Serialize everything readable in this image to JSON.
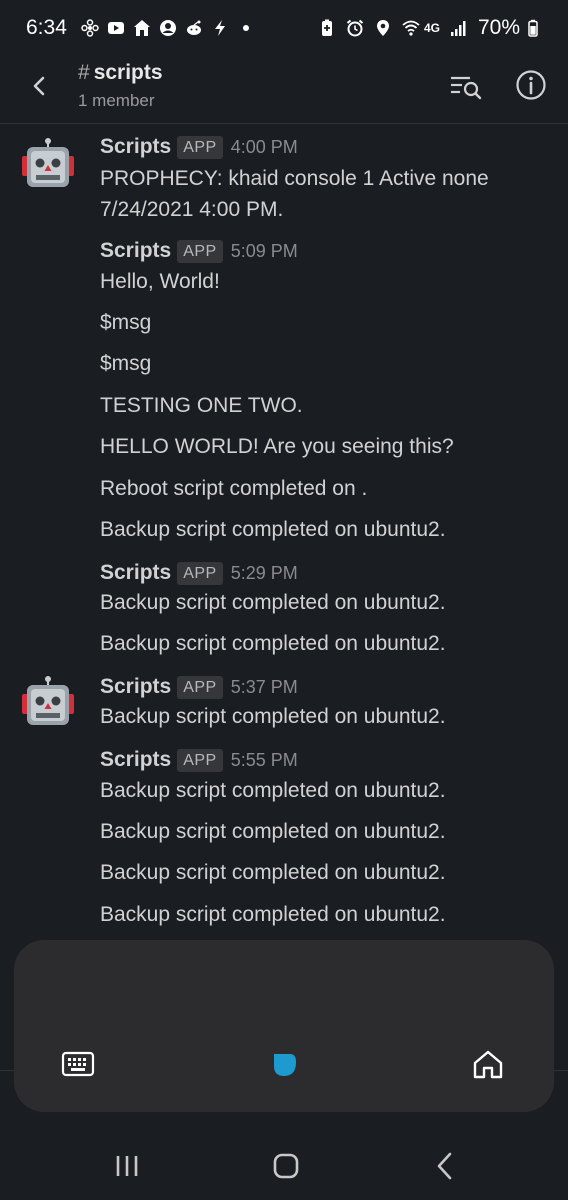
{
  "status_bar": {
    "time": "6:34",
    "network": "4G",
    "battery": "70%"
  },
  "header": {
    "hash": "#",
    "channel": "scripts",
    "member_count": "1 member"
  },
  "messages": [
    {
      "sender": "Scripts",
      "badge": "APP",
      "time": "4:00 PM",
      "lines": [
        "PROPHECY:  khaid console 1 Active none",
        "7/24/2021 4:00 PM."
      ]
    },
    {
      "sender": "Scripts",
      "badge": "APP",
      "time": "5:09 PM",
      "lines": [
        "Hello, World!",
        "$msg",
        "$msg",
        "TESTING ONE TWO.",
        "HELLO WORLD! Are you seeing this?",
        "Reboot script completed on .",
        "Backup script completed on ubuntu2."
      ]
    },
    {
      "sender": "Scripts",
      "badge": "APP",
      "time": "5:29 PM",
      "lines": [
        "Backup script completed on ubuntu2.",
        "Backup script completed on ubuntu2."
      ]
    },
    {
      "sender": "Scripts",
      "badge": "APP",
      "time": "5:37 PM",
      "lines": [
        "Backup script completed on ubuntu2."
      ]
    },
    {
      "sender": "Scripts",
      "badge": "APP",
      "time": "5:55 PM",
      "lines": [
        "Backup script completed on ubuntu2.",
        "Backup script completed on ubuntu2.",
        "Backup script completed on ubuntu2.",
        "Backup script completed on ubuntu2."
      ]
    }
  ],
  "icons": {
    "back": "back-arrow-icon",
    "search": "search-messages-icon",
    "info": "info-icon",
    "keyboard": "keyboard-icon",
    "assistant": "assistant-drop-icon",
    "home": "home-icon",
    "recents": "recents-icon",
    "nav_home": "nav-home-icon",
    "nav_back": "nav-back-icon"
  },
  "colors": {
    "background": "#1a1d21",
    "text": "#d1d2d3",
    "accent": "#1d9bd1"
  }
}
